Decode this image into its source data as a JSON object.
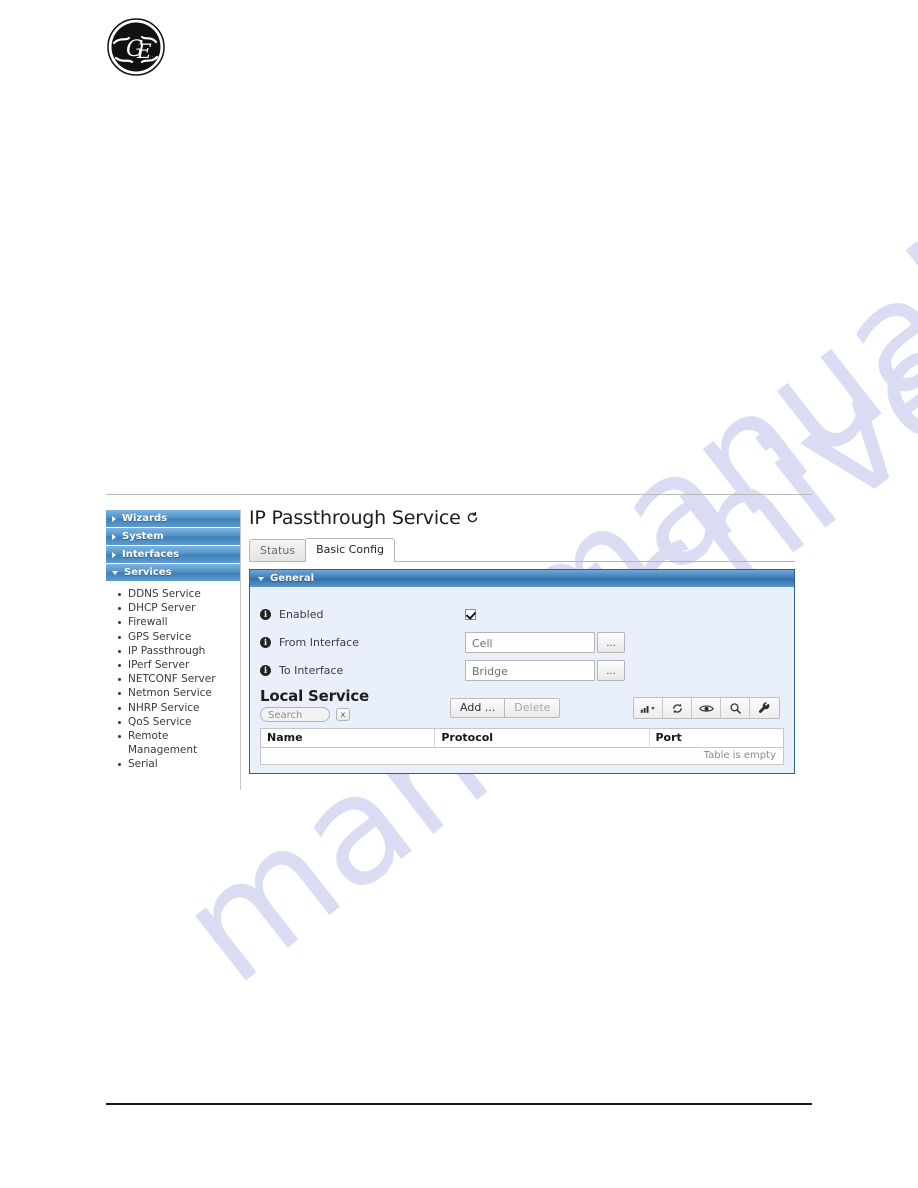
{
  "watermark": {
    "text": "manualshive.com"
  },
  "logo": {
    "name": "ge-logo",
    "alt": "GE"
  },
  "sidebar": {
    "headers": [
      {
        "label": "Wizards",
        "expanded": false
      },
      {
        "label": "System",
        "expanded": false
      },
      {
        "label": "Interfaces",
        "expanded": false
      },
      {
        "label": "Services",
        "expanded": true
      }
    ],
    "services_items": [
      "DDNS Service",
      "DHCP Server",
      "Firewall",
      "GPS Service",
      "IP Passthrough",
      "IPerf Server",
      "NETCONF Server",
      "Netmon Service",
      "NHRP Service",
      "QoS Service",
      "Remote",
      "Management",
      "Serial"
    ]
  },
  "header": {
    "title": "IP Passthrough Service",
    "refresh_icon": "refresh-icon"
  },
  "tabs": [
    {
      "label": "Status",
      "active": false
    },
    {
      "label": "Basic Config",
      "active": true
    }
  ],
  "panel": {
    "title": "General",
    "collapse_icon": "chevron-down-icon",
    "fields": [
      {
        "label": "Enabled",
        "type": "checkbox",
        "value": "checked",
        "info_icon": "info-icon"
      },
      {
        "label": "From Interface",
        "type": "text",
        "value": "Cell",
        "browse_label": "...",
        "info_icon": "info-icon"
      },
      {
        "label": "To Interface",
        "type": "text",
        "value": "Bridge",
        "browse_label": "...",
        "info_icon": "info-icon"
      }
    ]
  },
  "local_service": {
    "title": "Local Service",
    "search": {
      "placeholder": "Search",
      "value": "",
      "clear_label": "x"
    },
    "buttons": [
      {
        "label": "Add ...",
        "enabled": true
      },
      {
        "label": "Delete",
        "enabled": false
      }
    ],
    "toolbar_icons": [
      "bar-chart-icon",
      "refresh-icon",
      "eye-icon",
      "search-icon",
      "wrench-icon"
    ],
    "table": {
      "columns": [
        "Name",
        "Protocol",
        "Port"
      ],
      "rows": [],
      "empty_text": "Table is empty"
    }
  },
  "colors": {
    "nav_blue": "#3c7fb6",
    "panel_border": "#2b5f96",
    "panel_bg": "#eaf0fb",
    "watermark": "#d9dcf2"
  }
}
